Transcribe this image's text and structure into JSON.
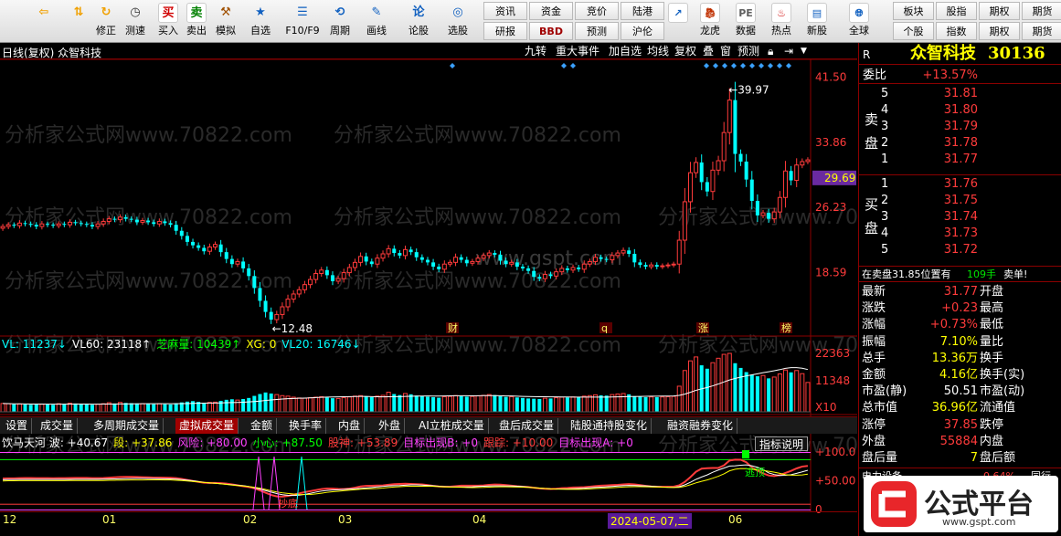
{
  "toolbar": {
    "buttons": [
      {
        "label": "",
        "icon": "back-arrow-icon"
      },
      {
        "label": "",
        "icon": "up-down-arrow-icon"
      },
      {
        "label": "修正",
        "icon": "refresh-icon"
      },
      {
        "label": "测速",
        "icon": "clock-icon"
      },
      {
        "label": "买入",
        "icon": "buy-icon",
        "glyph": "买"
      },
      {
        "label": "卖出",
        "icon": "sell-icon",
        "glyph": "卖"
      },
      {
        "label": "模拟",
        "icon": "hammer-icon"
      },
      {
        "label": "自选",
        "icon": "star-icon"
      },
      {
        "label": "F10/F9",
        "icon": "f10-icon"
      },
      {
        "label": "周期",
        "icon": "period-icon"
      },
      {
        "label": "画线",
        "icon": "pencil-icon"
      },
      {
        "label": "论股",
        "icon": "discuss-icon",
        "glyph": "论"
      },
      {
        "label": "选股",
        "icon": "select-stock-icon"
      }
    ],
    "text_buttons_row1": [
      "资讯",
      "资金",
      "竞价",
      "陆港"
    ],
    "text_buttons_row2": [
      "研报",
      "BBD",
      "预测",
      "沪伦"
    ],
    "icon_buttons2": [
      {
        "label": "龙虎",
        "icon": "dragon-tiger-icon"
      },
      {
        "label": "数据",
        "icon": "data-icon"
      },
      {
        "label": "热点",
        "icon": "hot-icon"
      },
      {
        "label": "新股",
        "icon": "new-stock-icon"
      },
      {
        "label": "全球",
        "icon": "globe-icon"
      }
    ],
    "right_buttons_row1": [
      "板块",
      "股指",
      "期权",
      "期货"
    ],
    "right_buttons_row2": [
      "个股",
      "指数",
      "期权",
      "期货"
    ]
  },
  "chart_header": {
    "title": "日线(复权)  众智科技",
    "buttons": [
      "九转",
      "重大事件",
      "加自选",
      "均线",
      "复权",
      "叠",
      "窗",
      "预测"
    ],
    "lock_icon": "lock-icon",
    "nav_icon": "arrow-right-icon"
  },
  "price_axis": [
    "41.50",
    "33.86",
    "29.69",
    "26.23",
    "18.59"
  ],
  "volume_axis": [
    "22363",
    "11348",
    "X10"
  ],
  "indicator_axis": [
    "+100.0",
    "+50.00",
    "0"
  ],
  "annotations": {
    "high": "39.97",
    "low": "12.48",
    "markers": [
      "财",
      "q",
      "涨",
      "榜"
    ]
  },
  "volume_legend": [
    {
      "text": "VL: 11237↓",
      "color": "#00ffff"
    },
    {
      "text": "VL60: 23118↑",
      "color": "#ffffff"
    },
    {
      "text": "芝麻量: 10439↑",
      "color": "#00ff00"
    },
    {
      "text": "XG: 0",
      "color": "#ffff00"
    },
    {
      "text": "VL20: 16746↓",
      "color": "#00ffff"
    }
  ],
  "tabs": [
    "设置",
    "成交量",
    "多周期成交量",
    "虚拟成交量",
    "金额",
    "换手率",
    "内盘",
    "外盘",
    "AI立桩成交量",
    "盘后成交量",
    "陆股通持股变化",
    "融资融券变化"
  ],
  "active_tab": "虚拟成交量",
  "indicator_legend": [
    {
      "text": "饮马天河 波: +40.67",
      "color": "#ffffff"
    },
    {
      "text": "段: +37.86",
      "color": "#ffff00"
    },
    {
      "text": "风险: +80.00",
      "color": "#ff40ff"
    },
    {
      "text": "小心: +87.50",
      "color": "#00ff00"
    },
    {
      "text": "股神: +53.89",
      "color": "#ff3b3b"
    },
    {
      "text": "目标出现B: +0",
      "color": "#ff40ff"
    },
    {
      "text": "跟踪: +10.00",
      "color": "#ff3b3b"
    },
    {
      "text": "目标出现A: +0",
      "color": "#ff40ff"
    }
  ],
  "indicator_button": "指标说明",
  "indicator_labels": [
    "抄底",
    "逃顶"
  ],
  "x_axis": [
    "12",
    "01",
    "02",
    "03",
    "04",
    "2024-05-07,二",
    "06"
  ],
  "quote": {
    "name": "众智科技",
    "code": "30136",
    "corner": "R",
    "webi_label": "委比",
    "webi_value": "+13.57%",
    "sell_label": "卖盘",
    "buy_label": "买盘",
    "sell": [
      {
        "lvl": "5",
        "price": "31.81",
        "vol": ""
      },
      {
        "lvl": "4",
        "price": "31.80",
        "vol": ""
      },
      {
        "lvl": "3",
        "price": "31.79",
        "vol": ""
      },
      {
        "lvl": "2",
        "price": "31.78",
        "vol": ""
      },
      {
        "lvl": "1",
        "price": "31.77",
        "vol": ""
      }
    ],
    "buy": [
      {
        "lvl": "1",
        "price": "31.76",
        "vol": ""
      },
      {
        "lvl": "2",
        "price": "31.75",
        "vol": ""
      },
      {
        "lvl": "3",
        "price": "31.74",
        "vol": ""
      },
      {
        "lvl": "4",
        "price": "31.73",
        "vol": ""
      },
      {
        "lvl": "5",
        "price": "31.72",
        "vol": ""
      }
    ],
    "status_line": "在卖盘31.85位置有",
    "status_qty": "109手",
    "status_action": "卖单!",
    "stats": [
      {
        "l": "最新",
        "v": "31.77",
        "vc": "red",
        "l2": "开盘",
        "v2": ""
      },
      {
        "l": "涨跌",
        "v": "+0.23",
        "vc": "red",
        "l2": "最高",
        "v2": ""
      },
      {
        "l": "涨幅",
        "v": "+0.73%",
        "vc": "red",
        "l2": "最低",
        "v2": ""
      },
      {
        "l": "振幅",
        "v": "7.10%",
        "vc": "yellow",
        "l2": "量比",
        "v2": ""
      },
      {
        "l": "总手",
        "v": "13.36万",
        "vc": "yellow",
        "l2": "换手",
        "v2": ""
      },
      {
        "l": "金额",
        "v": "4.16亿",
        "vc": "yellow",
        "l2": "换手(实)",
        "v2": ""
      },
      {
        "l": "市盈(静)",
        "v": "50.51",
        "vc": "white",
        "l2": "市盈(动)",
        "v2": ""
      },
      {
        "l": "总市值",
        "v": "36.96亿",
        "vc": "yellow",
        "l2": "流通值",
        "v2": ""
      },
      {
        "l": "涨停",
        "v": "37.85",
        "vc": "red",
        "l2": "跌停",
        "v2": ""
      },
      {
        "l": "外盘",
        "v": "55884",
        "vc": "red",
        "l2": "内盘",
        "v2": ""
      },
      {
        "l": "盘后量",
        "v": "7",
        "vc": "yellow",
        "l2": "盘后额",
        "v2": ""
      }
    ],
    "sector": "电力设备",
    "sector_pct": "0.64%",
    "sector_more": "同行"
  },
  "current_price_tag": "29.69",
  "watermarks": [
    "分析家公式网www.70822.com",
    "www.gspt.com"
  ],
  "logo": {
    "text": "公式平台",
    "url": "www.gspt.com"
  },
  "colors": {
    "up": "#ff3b3b",
    "down": "#00ffff",
    "accent": "#8b0000"
  },
  "chart_data": {
    "type": "candlestick",
    "title": "日线(复权) 众智科技",
    "ylim": [
      11.5,
      42.5
    ],
    "annotated_high": 39.97,
    "annotated_low": 12.48,
    "close": [
      24.0,
      24.2,
      24.1,
      24.4,
      24.3,
      24.2,
      24.0,
      24.3,
      24.2,
      24.1,
      24.3,
      24.2,
      24.5,
      24.4,
      24.3,
      24.2,
      24.0,
      24.3,
      24.6,
      24.9,
      24.8,
      25.1,
      24.9,
      24.8,
      24.5,
      24.7,
      24.5,
      24.3,
      24.6,
      24.4,
      24.2,
      23.5,
      22.9,
      22.2,
      21.8,
      21.5,
      21.1,
      21.6,
      21.9,
      21.0,
      20.2,
      19.6,
      19.9,
      19.1,
      18.2,
      16.8,
      15.3,
      14.0,
      13.1,
      13.7,
      14.6,
      15.5,
      16.1,
      16.6,
      17.2,
      17.8,
      18.5,
      18.9,
      18.3,
      17.6,
      17.9,
      18.6,
      19.2,
      19.8,
      20.5,
      19.9,
      19.6,
      20.3,
      20.8,
      21.4,
      20.9,
      20.6,
      21.3,
      21.0,
      20.4,
      20.1,
      19.8,
      19.3,
      19.0,
      19.6,
      19.8,
      20.4,
      20.1,
      19.7,
      19.9,
      20.3,
      20.6,
      20.9,
      20.7,
      20.0,
      19.6,
      19.8,
      19.3,
      19.1,
      18.8,
      18.1,
      17.9,
      18.4,
      18.2,
      18.7,
      19.1,
      18.9,
      19.2,
      19.0,
      19.6,
      19.9,
      20.4,
      20.2,
      20.1,
      20.6,
      20.9,
      21.2,
      20.8,
      19.8,
      19.5,
      19.3,
      19.5,
      19.3,
      19.4,
      19.5,
      19.6,
      22.4,
      26.9,
      30.3,
      31.5,
      29.2,
      28.1,
      30.6,
      31.7,
      35.0,
      38.8,
      32.5,
      31.6,
      29.5,
      27.0,
      25.3,
      25.6,
      24.9,
      25.7,
      27.4,
      30.5,
      29.4,
      31.2,
      31.6,
      31.8
    ],
    "volume": [
      3200,
      3100,
      2900,
      3000,
      2800,
      2700,
      3000,
      2900,
      2800,
      2700,
      3100,
      2900,
      3300,
      3200,
      3000,
      2800,
      2700,
      2900,
      3100,
      3500,
      3200,
      3600,
      3400,
      3300,
      3200,
      3100,
      3000,
      2900,
      3100,
      2900,
      2800,
      3300,
      3600,
      3900,
      4100,
      3800,
      3500,
      3600,
      3700,
      4200,
      4600,
      4800,
      4500,
      4900,
      5300,
      6100,
      6800,
      7400,
      7000,
      6600,
      6200,
      6000,
      5600,
      5300,
      5200,
      5400,
      5600,
      5800,
      5500,
      5200,
      5100,
      5400,
      5700,
      6000,
      6200,
      5800,
      5600,
      6000,
      6300,
      7500,
      6800,
      6400,
      7000,
      6700,
      6200,
      6000,
      5800,
      5600,
      5400,
      5800,
      5900,
      6200,
      6000,
      5800,
      5900,
      6100,
      6300,
      6600,
      6400,
      6000,
      5700,
      5800,
      5500,
      5300,
      5100,
      5000,
      4900,
      5200,
      5100,
      5400,
      5600,
      5500,
      5700,
      5600,
      6000,
      6200,
      6500,
      6300,
      6200,
      6600,
      6800,
      7000,
      6700,
      6000,
      5800,
      5600,
      5700,
      5600,
      5700,
      5800,
      5900,
      9800,
      15800,
      19500,
      21000,
      17800,
      16500,
      18800,
      20500,
      22000,
      22363,
      18600,
      16800,
      15200,
      14200,
      13600,
      13900,
      12800,
      13300,
      14500,
      16000,
      15100,
      15800,
      14600,
      11237
    ]
  }
}
